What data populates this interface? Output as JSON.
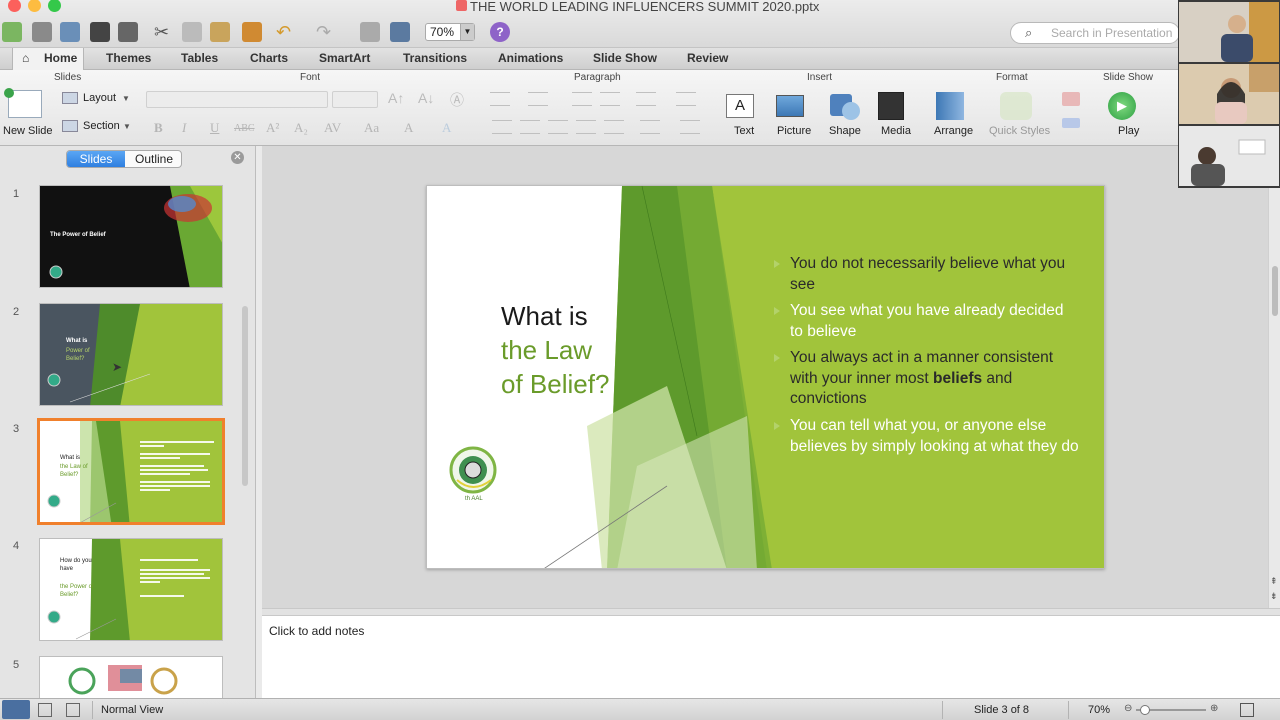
{
  "window": {
    "title": "THE WORLD LEADING INFLUENCERS SUMMIT 2020.pptx"
  },
  "toolbar": {
    "zoom": "70%"
  },
  "search": {
    "placeholder": "Search in Presentation"
  },
  "ribbon_tabs": [
    "Home",
    "Themes",
    "Tables",
    "Charts",
    "SmartArt",
    "Transitions",
    "Animations",
    "Slide Show",
    "Review"
  ],
  "ribbon_groups": {
    "slides": "Slides",
    "font": "Font",
    "paragraph": "Paragraph",
    "insert": "Insert",
    "format": "Format",
    "slide_show": "Slide Show"
  },
  "ribbon_buttons": {
    "new_slide": "New Slide",
    "layout": "Layout",
    "section": "Section",
    "text": "Text",
    "picture": "Picture",
    "shape": "Shape",
    "media": "Media",
    "arrange": "Arrange",
    "quick_styles": "Quick Styles",
    "play": "Play"
  },
  "sidebar": {
    "tab_slides": "Slides",
    "tab_outline": "Outline",
    "slide_numbers": [
      "1",
      "2",
      "3",
      "4",
      "5"
    ]
  },
  "thumbs": {
    "t1_title": "The Power of Belief",
    "t2_title": "What is",
    "t2_green": "Power of Belief?",
    "t3_title": "What is",
    "t3_green": "the Law of Belief?",
    "t4_title": "How do you have",
    "t4_green": "the Power of Belief?"
  },
  "slide": {
    "title_line1": "What is",
    "title_line2": "the Law",
    "title_line3": "of Belief?",
    "bullets": [
      {
        "text": "You do not necessarily believe what you see"
      },
      {
        "text": "You see what you have already decided to believe"
      },
      {
        "pre": "You always act in a manner consistent with your inner most ",
        "bold": "beliefs",
        "post": " and convictions"
      },
      {
        "text": "You can tell what you, or anyone else believes by simply looking at what they do"
      }
    ]
  },
  "notes": {
    "placeholder": "Click to add notes"
  },
  "status": {
    "view": "Normal View",
    "slide_pos": "Slide 3 of 8",
    "zoom": "70%"
  },
  "colors": {
    "accent_green": "#a1c43b",
    "dark_green": "#5e9a2c",
    "selection_orange": "#f0802c",
    "tab_blue": "#2f7fe0"
  }
}
